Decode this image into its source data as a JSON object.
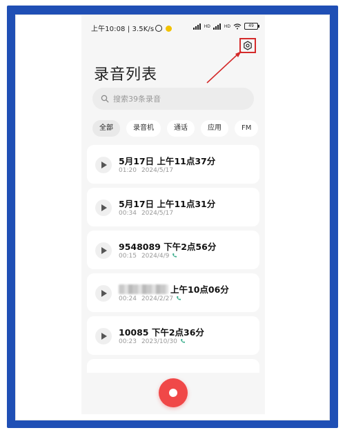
{
  "status_bar": {
    "time_speed": "上午10:08 | 3.5K/s",
    "hd1": "HD",
    "hd2": "HD",
    "battery": "49"
  },
  "header": {
    "title": "录音列表",
    "settings_icon": "hexagon-settings-icon"
  },
  "search": {
    "placeholder": "搜索39条录音"
  },
  "filters": [
    {
      "label": "全部",
      "active": true
    },
    {
      "label": "录音机",
      "active": false
    },
    {
      "label": "通话",
      "active": false
    },
    {
      "label": "应用",
      "active": false
    },
    {
      "label": "FM",
      "active": false
    }
  ],
  "recordings": [
    {
      "title": "5月17日 上午11点37分",
      "duration": "01:20",
      "date": "2024/5/17",
      "call": false
    },
    {
      "title": "5月17日 上午11点31分",
      "duration": "00:34",
      "date": "2024/5/17",
      "call": false
    },
    {
      "title": "9548089 下午2点56分",
      "duration": "00:15",
      "date": "2024/4/9",
      "call": true
    },
    {
      "title": "上午10点06分",
      "duration": "00:24",
      "date": "2024/2/27",
      "call": true,
      "redacted_prefix": true
    },
    {
      "title": "10085 下午2点36分",
      "duration": "00:23",
      "date": "2023/10/30",
      "call": true
    }
  ],
  "colors": {
    "frame": "#1f4fb5",
    "annotation": "#d42a2a",
    "record": "#f04848",
    "call_icon": "#3fb08f"
  }
}
